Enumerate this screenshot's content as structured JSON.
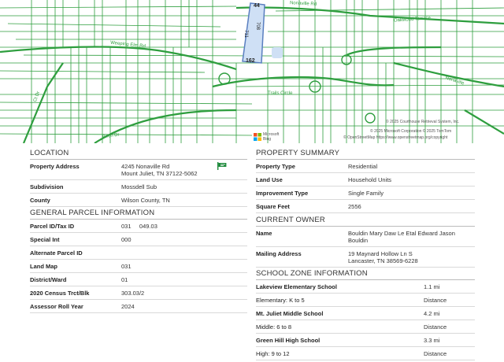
{
  "map": {
    "streets": {
      "nonaville": "Nonaville Rd",
      "oakwood": "Oakwood Terrace",
      "weeping_elm": "Weeping Elm Rd",
      "trails": "Trails Circle",
      "left_street": "Ct Dr",
      "bottom_left": "Birch Dr",
      "right_street": "Nonaville"
    },
    "parcel_labels": {
      "top": "44",
      "left": "711",
      "right": "708",
      "bottom": "162"
    },
    "credits": {
      "line1": "© 2025 Courthouse Retrieval System, Inc.",
      "line2": "© 2025 Microsoft Corporation © 2025 TomTom",
      "line3": "© OpenStreetMap https://www.openstreetmap.org/copyright",
      "logo": "Microsoft Bing"
    },
    "colors": {
      "lines": "#2e9e3e",
      "parcel_fill": "#cfe0f5",
      "parcel_stroke": "#5a7fc0"
    }
  },
  "location": {
    "title": "LOCATION",
    "rows": [
      {
        "label": "Property Address",
        "value": "4245 Nonaville Rd\nMount Juliet, TN 37122-5062"
      },
      {
        "label": "Subdivision",
        "value": "Mossdell Sub"
      },
      {
        "label": "County",
        "value": "Wilson County, TN"
      }
    ]
  },
  "general": {
    "title": "GENERAL PARCEL INFORMATION",
    "rows": [
      {
        "label": "Parcel ID/Tax ID",
        "value": "031     049.03"
      },
      {
        "label": "Special Int",
        "value": "000"
      },
      {
        "label": "Alternate Parcel ID",
        "value": ""
      },
      {
        "label": "Land Map",
        "value": "031"
      },
      {
        "label": "District/Ward",
        "value": "01"
      },
      {
        "label": "2020 Census Trct/Blk",
        "value": "303.03/2"
      },
      {
        "label": "Assessor Roll Year",
        "value": "2024"
      }
    ]
  },
  "summary": {
    "title": "PROPERTY SUMMARY",
    "rows": [
      {
        "label": "Property Type",
        "value": "Residential"
      },
      {
        "label": "Land Use",
        "value": "Household Units"
      },
      {
        "label": "Improvement Type",
        "value": "Single Family"
      },
      {
        "label": "Square Feet",
        "value": "2556"
      }
    ]
  },
  "owner": {
    "title": "CURRENT OWNER",
    "rows": [
      {
        "label": "Name",
        "value": "Bouldin Mary Daw Le Etal Edward Jason\nBouldin"
      },
      {
        "label": "Mailing Address",
        "value": "19 Maynard Hollow Ln S\nLancaster, TN 38569-6228"
      }
    ]
  },
  "school": {
    "title": "SCHOOL ZONE INFORMATION",
    "rows": [
      {
        "label": "Lakeview Elementary School",
        "value": "1.1 mi",
        "bold": true
      },
      {
        "label": "Elementary: K to 5",
        "value": "Distance",
        "bold": false
      },
      {
        "label": "Mt. Juliet Middle School",
        "value": "4.2 mi",
        "bold": true
      },
      {
        "label": "Middle: 6 to 8",
        "value": "Distance",
        "bold": false
      },
      {
        "label": "Green Hill High School",
        "value": "3.3 mi",
        "bold": true
      },
      {
        "label": "High: 9 to 12",
        "value": "Distance",
        "bold": false
      }
    ]
  }
}
